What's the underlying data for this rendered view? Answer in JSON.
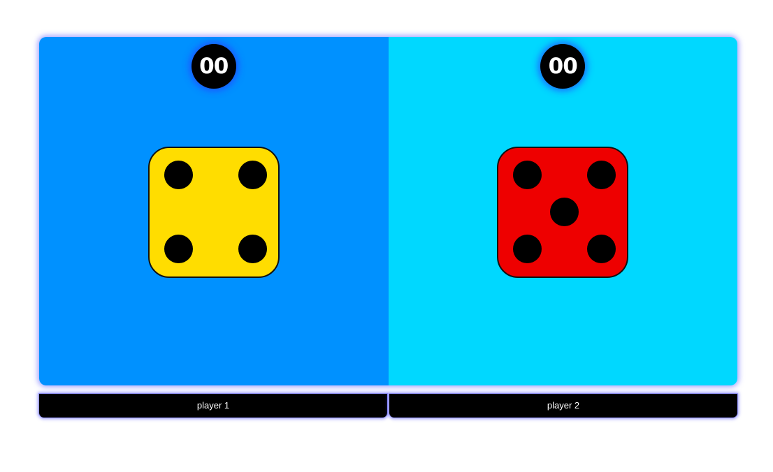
{
  "players": [
    {
      "name": "player 1",
      "score": "00",
      "panel_color": "#0091ff",
      "die_color": "#ffdd00",
      "die_value": 4
    },
    {
      "name": "player 2",
      "score": "00",
      "panel_color": "#00d8ff",
      "die_color": "#ee0000",
      "die_value": 5
    }
  ],
  "colors": {
    "glow": "#5a5aff",
    "score_bg": "#000000",
    "pip": "#000000"
  }
}
